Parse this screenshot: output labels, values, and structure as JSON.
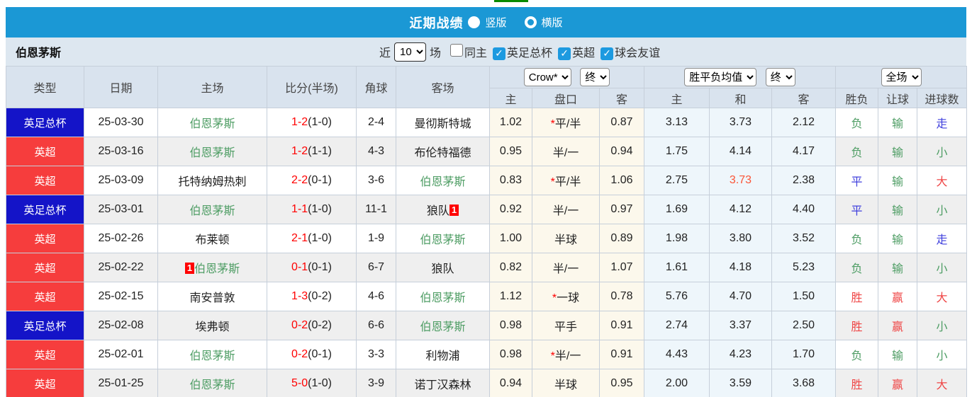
{
  "colors": {
    "bar_blue": "#1b98d5",
    "badge_blue": "#1414c8",
    "badge_red": "#f63d3d",
    "score_red": "#ff0000",
    "team_green": "#4e9d64",
    "red": "#ef4646",
    "green": "#4e9d64",
    "blue": "#4040dd",
    "draw_highlight": "#fa5537",
    "check_blue": "#1d9ae0"
  },
  "title_bar": {
    "title": "近期战绩",
    "radios": [
      {
        "label": "竖版",
        "selected": true
      },
      {
        "label": "横版",
        "selected": false
      }
    ]
  },
  "filter_bar": {
    "team": "伯恩茅斯",
    "near_label": "近",
    "games_value": "10",
    "games_suffix": "场",
    "checkboxes": [
      {
        "label": "同主",
        "checked": false
      },
      {
        "label": "英足总杯",
        "checked": true
      },
      {
        "label": "英超",
        "checked": true
      },
      {
        "label": "球会友谊",
        "checked": true
      }
    ]
  },
  "table": {
    "selects": {
      "company": "Crow*",
      "final1": "终",
      "avg": "胜平负均值",
      "final2": "终",
      "scope": "全场"
    },
    "columns": [
      "类型",
      "日期",
      "主场",
      "比分(半场)",
      "角球",
      "客场",
      "主",
      "盘口",
      "客",
      "主",
      "和",
      "客",
      "胜负",
      "让球",
      "进球数"
    ],
    "rows": [
      {
        "type": "英足总杯",
        "type_color": "blue",
        "date": "25-03-30",
        "home": "伯恩茅斯",
        "home_green": true,
        "home_badge": "",
        "score_full": "1-2",
        "score_half": "(1-0)",
        "corner": "2-4",
        "away": "曼彻斯特城",
        "away_green": false,
        "away_badge": "",
        "ah_home": "1.02",
        "ah_line": "*平/半",
        "ah_away": "0.87",
        "avg_home": "3.13",
        "avg_draw": "3.73",
        "avg_draw_highlight": false,
        "avg_away": "2.12",
        "result": "负",
        "result_color": "green",
        "let_result": "输",
        "let_color": "green",
        "goals": "走",
        "goals_color": "blue"
      },
      {
        "type": "英超",
        "type_color": "red",
        "date": "25-03-16",
        "home": "伯恩茅斯",
        "home_green": true,
        "home_badge": "",
        "score_full": "1-2",
        "score_half": "(1-1)",
        "corner": "4-3",
        "away": "布伦特福德",
        "away_green": false,
        "away_badge": "",
        "ah_home": "0.95",
        "ah_line": "半/一",
        "ah_away": "0.94",
        "avg_home": "1.75",
        "avg_draw": "4.14",
        "avg_draw_highlight": false,
        "avg_away": "4.17",
        "result": "负",
        "result_color": "green",
        "let_result": "输",
        "let_color": "green",
        "goals": "小",
        "goals_color": "green"
      },
      {
        "type": "英超",
        "type_color": "red",
        "date": "25-03-09",
        "home": "托特纳姆热刺",
        "home_green": false,
        "home_badge": "",
        "score_full": "2-2",
        "score_half": "(0-1)",
        "corner": "3-6",
        "away": "伯恩茅斯",
        "away_green": true,
        "away_badge": "",
        "ah_home": "0.83",
        "ah_line": "*平/半",
        "ah_away": "1.06",
        "avg_home": "2.75",
        "avg_draw": "3.73",
        "avg_draw_highlight": true,
        "avg_away": "2.38",
        "result": "平",
        "result_color": "blue",
        "let_result": "输",
        "let_color": "green",
        "goals": "大",
        "goals_color": "red"
      },
      {
        "type": "英足总杯",
        "type_color": "blue",
        "date": "25-03-01",
        "home": "伯恩茅斯",
        "home_green": true,
        "home_badge": "",
        "score_full": "1-1",
        "score_half": "(1-0)",
        "corner": "11-1",
        "away": "狼队",
        "away_green": false,
        "away_badge": "1",
        "ah_home": "0.92",
        "ah_line": "半/一",
        "ah_away": "0.97",
        "avg_home": "1.69",
        "avg_draw": "4.12",
        "avg_draw_highlight": false,
        "avg_away": "4.40",
        "result": "平",
        "result_color": "blue",
        "let_result": "输",
        "let_color": "green",
        "goals": "小",
        "goals_color": "green"
      },
      {
        "type": "英超",
        "type_color": "red",
        "date": "25-02-26",
        "home": "布莱顿",
        "home_green": false,
        "home_badge": "",
        "score_full": "2-1",
        "score_half": "(1-0)",
        "corner": "1-9",
        "away": "伯恩茅斯",
        "away_green": true,
        "away_badge": "",
        "ah_home": "1.00",
        "ah_line": "半球",
        "ah_away": "0.89",
        "avg_home": "1.98",
        "avg_draw": "3.80",
        "avg_draw_highlight": false,
        "avg_away": "3.52",
        "result": "负",
        "result_color": "green",
        "let_result": "输",
        "let_color": "green",
        "goals": "走",
        "goals_color": "blue"
      },
      {
        "type": "英超",
        "type_color": "red",
        "date": "25-02-22",
        "home": "伯恩茅斯",
        "home_green": true,
        "home_badge": "1",
        "score_full": "0-1",
        "score_half": "(0-1)",
        "corner": "6-7",
        "away": "狼队",
        "away_green": false,
        "away_badge": "",
        "ah_home": "0.82",
        "ah_line": "半/一",
        "ah_away": "1.07",
        "avg_home": "1.61",
        "avg_draw": "4.18",
        "avg_draw_highlight": false,
        "avg_away": "5.23",
        "result": "负",
        "result_color": "green",
        "let_result": "输",
        "let_color": "green",
        "goals": "小",
        "goals_color": "green"
      },
      {
        "type": "英超",
        "type_color": "red",
        "date": "25-02-15",
        "home": "南安普敦",
        "home_green": false,
        "home_badge": "",
        "score_full": "1-3",
        "score_half": "(0-2)",
        "corner": "4-6",
        "away": "伯恩茅斯",
        "away_green": true,
        "away_badge": "",
        "ah_home": "1.12",
        "ah_line": "*一球",
        "ah_away": "0.78",
        "avg_home": "5.76",
        "avg_draw": "4.70",
        "avg_draw_highlight": false,
        "avg_away": "1.50",
        "result": "胜",
        "result_color": "red",
        "let_result": "赢",
        "let_color": "red",
        "goals": "大",
        "goals_color": "red"
      },
      {
        "type": "英足总杯",
        "type_color": "blue",
        "date": "25-02-08",
        "home": "埃弗顿",
        "home_green": false,
        "home_badge": "",
        "score_full": "0-2",
        "score_half": "(0-2)",
        "corner": "6-6",
        "away": "伯恩茅斯",
        "away_green": true,
        "away_badge": "",
        "ah_home": "0.98",
        "ah_line": "平手",
        "ah_away": "0.91",
        "avg_home": "2.74",
        "avg_draw": "3.37",
        "avg_draw_highlight": false,
        "avg_away": "2.50",
        "result": "胜",
        "result_color": "red",
        "let_result": "赢",
        "let_color": "red",
        "goals": "小",
        "goals_color": "green"
      },
      {
        "type": "英超",
        "type_color": "red",
        "date": "25-02-01",
        "home": "伯恩茅斯",
        "home_green": true,
        "home_badge": "",
        "score_full": "0-2",
        "score_half": "(0-1)",
        "corner": "3-3",
        "away": "利物浦",
        "away_green": false,
        "away_badge": "",
        "ah_home": "0.98",
        "ah_line": "*半/一",
        "ah_away": "0.91",
        "avg_home": "4.43",
        "avg_draw": "4.23",
        "avg_draw_highlight": false,
        "avg_away": "1.70",
        "result": "负",
        "result_color": "green",
        "let_result": "输",
        "let_color": "green",
        "goals": "小",
        "goals_color": "green"
      },
      {
        "type": "英超",
        "type_color": "red",
        "date": "25-01-25",
        "home": "伯恩茅斯",
        "home_green": true,
        "home_badge": "",
        "score_full": "5-0",
        "score_half": "(1-0)",
        "corner": "3-9",
        "away": "诺丁汉森林",
        "away_green": false,
        "away_badge": "",
        "ah_home": "0.94",
        "ah_line": "半球",
        "ah_away": "0.95",
        "avg_home": "2.00",
        "avg_draw": "3.59",
        "avg_draw_highlight": false,
        "avg_away": "3.68",
        "result": "胜",
        "result_color": "red",
        "let_result": "赢",
        "let_color": "red",
        "goals": "大",
        "goals_color": "red"
      }
    ]
  }
}
